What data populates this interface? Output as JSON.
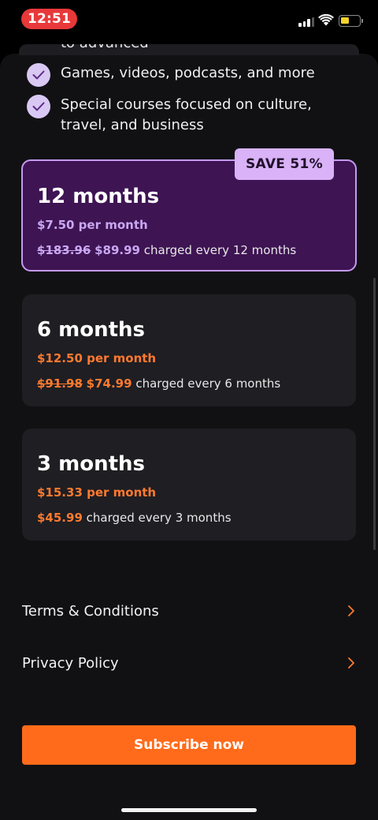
{
  "status_bar": {
    "time": "12:51"
  },
  "features": {
    "cut_off_text": "to advanced",
    "items": [
      {
        "label": "Games, videos, podcasts, and more"
      },
      {
        "label": "Special courses focused on culture, travel, and business"
      }
    ]
  },
  "plans": [
    {
      "title": "12 months",
      "monthly": "$7.50 per month",
      "original_price": "$183.96",
      "price": "$89.99",
      "billing": "charged every 12 months",
      "badge": "SAVE 51%",
      "selected": true
    },
    {
      "title": "6 months",
      "monthly": "$12.50 per month",
      "original_price": "$91.98",
      "price": "$74.99",
      "billing": "charged every 6 months",
      "selected": false
    },
    {
      "title": "3 months",
      "monthly": "$15.33 per month",
      "price": "$45.99",
      "billing": "charged every 3 months",
      "selected": false
    }
  ],
  "links": [
    {
      "label": "Terms & Conditions",
      "icon": "chevron-right-icon"
    },
    {
      "label": "Privacy Policy",
      "icon": "chevron-right-icon"
    }
  ],
  "subscribe_label": "Subscribe now",
  "colors": {
    "accent_orange": "#ff6b1a",
    "selected_card": "#3e1453",
    "selected_border": "#c59af0",
    "badge": "#d9b2f7",
    "time_pill": "#e8383a"
  }
}
